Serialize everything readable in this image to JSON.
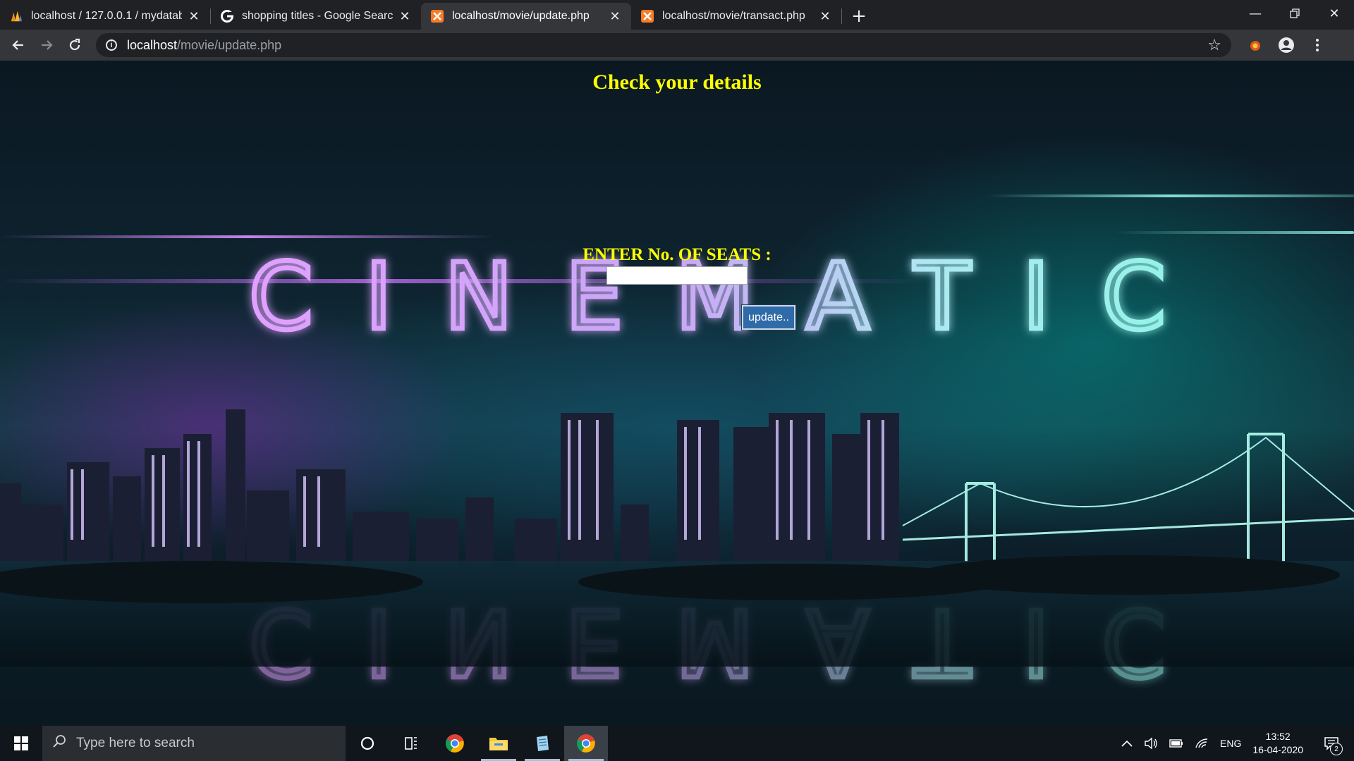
{
  "browser": {
    "tabs": [
      {
        "title": "localhost / 127.0.0.1 / mydatabas",
        "icon": "phpmyadmin-icon",
        "active": false
      },
      {
        "title": "shopping titles - Google Search",
        "icon": "google-icon",
        "active": false
      },
      {
        "title": "localhost/movie/update.php",
        "icon": "xampp-icon",
        "active": true
      },
      {
        "title": "localhost/movie/transact.php",
        "icon": "xampp-icon",
        "active": false
      }
    ],
    "new_tab_symbol": "+",
    "address": {
      "host": "localhost",
      "path": "/movie/update.php"
    }
  },
  "page": {
    "title": "Check your details",
    "background_text": "CINEMATIC",
    "seats_label": "ENTER No. OF SEATS :",
    "seats_value": "",
    "update_button": "update.."
  },
  "taskbar": {
    "search_placeholder": "Type here to search",
    "tray": {
      "language": "ENG",
      "time": "13:52",
      "date": "16-04-2020",
      "notifications": "2"
    }
  },
  "colors": {
    "heading": "#ffff00",
    "button": "#2f6ba8",
    "neon_purple": "#d58cf0",
    "neon_teal": "#8ff5e6"
  }
}
